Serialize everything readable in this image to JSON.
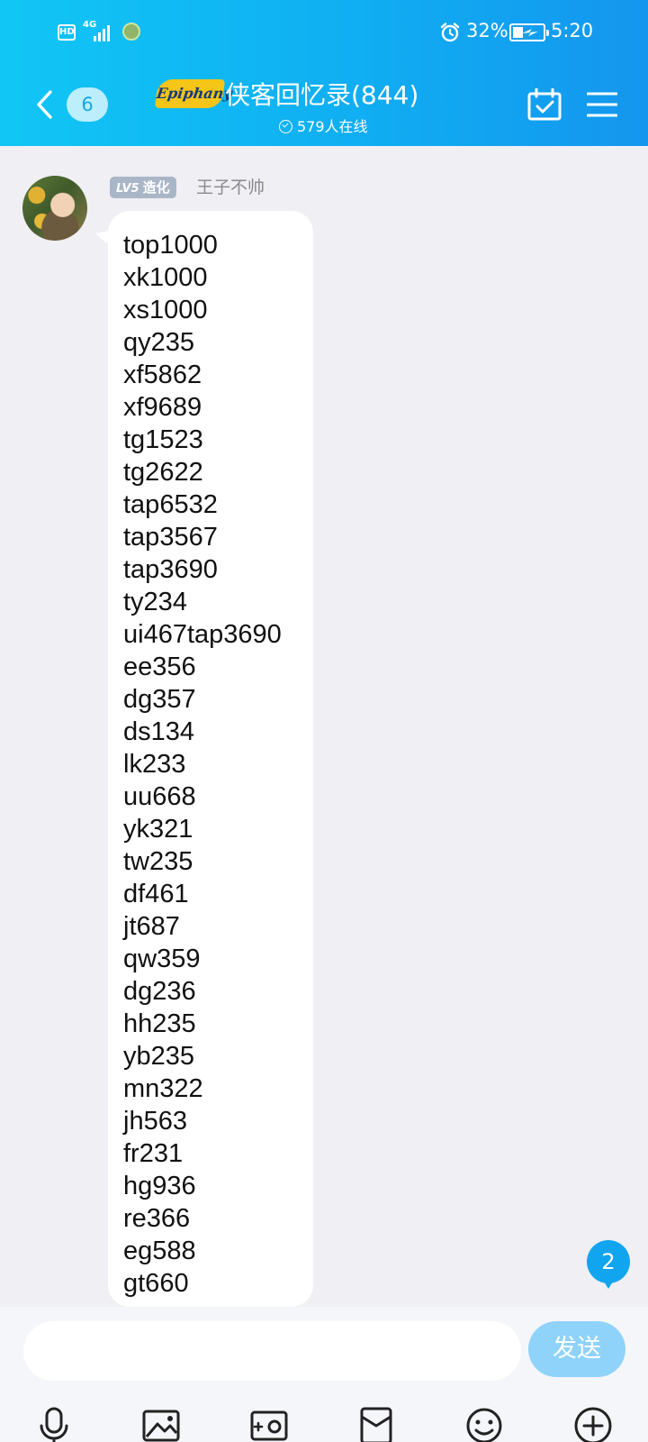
{
  "status_bar": {
    "hd": "HD",
    "network": "4G",
    "battery_percent": "32%",
    "time": "5:20"
  },
  "header": {
    "unread_count": "6",
    "logo_text": "Epiphany",
    "group_title": "侠客回忆录(844)",
    "online": "579人在线"
  },
  "message": {
    "level": "LV5",
    "level_title": "造化",
    "sender": "王子不帅",
    "lines": [
      "top1000",
      "xk1000",
      "xs1000",
      "qy235",
      "xf5862",
      "xf9689",
      "tg1523",
      "tg2622",
      "tap6532",
      "tap3567",
      "tap3690",
      "ty234",
      "ui467tap3690",
      "ee356",
      "dg357",
      "ds134",
      "lk233",
      "uu668",
      "yk321",
      "tw235",
      "df461",
      "jt687",
      "qw359",
      "dg236",
      "hh235",
      "yb235",
      "mn322",
      "jh563",
      "fr231",
      "hg936",
      "re366",
      "eg588",
      "gt660"
    ]
  },
  "new_messages_badge": "2",
  "input": {
    "placeholder": "",
    "send_label": "发送"
  },
  "colors": {
    "header_gradient_start": "#11c6f5",
    "header_gradient_end": "#1496ee",
    "chat_background": "#efeff4",
    "send_button": "#8fd3fb",
    "badge": "#12a5ef"
  },
  "icons": [
    "back-icon",
    "calendar-icon",
    "menu-icon",
    "microphone-icon",
    "image-icon",
    "camera-icon",
    "red-packet-icon",
    "emoji-icon",
    "plus-icon"
  ]
}
